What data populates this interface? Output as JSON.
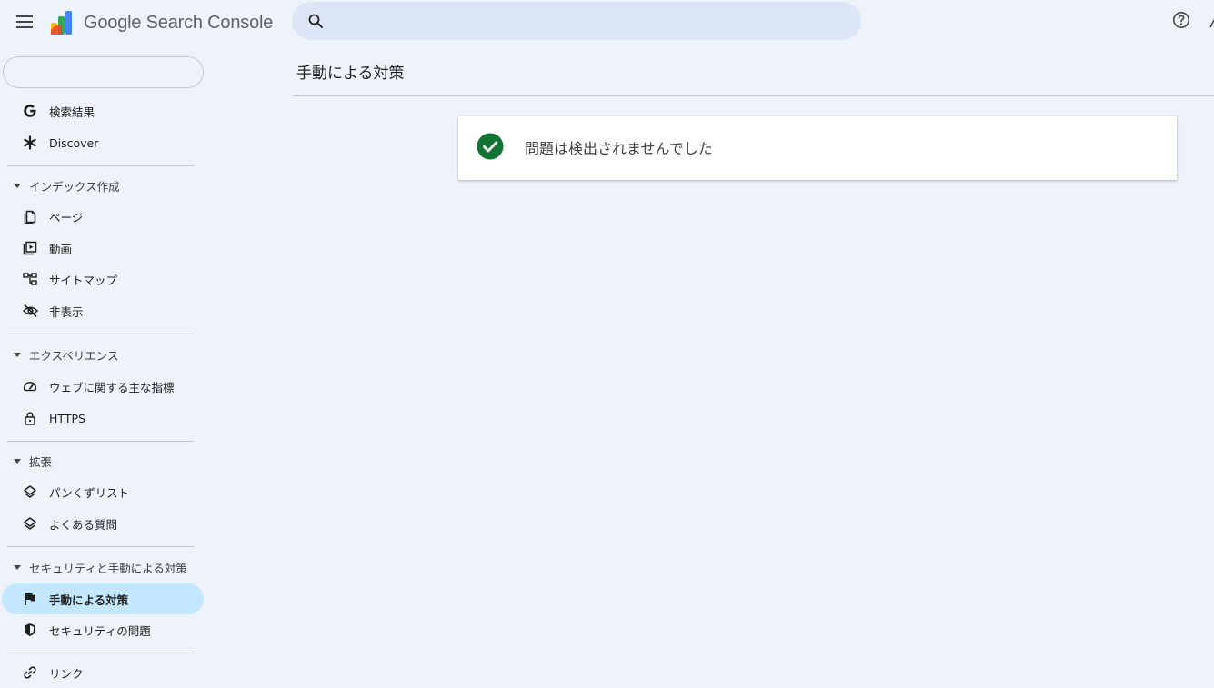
{
  "app": {
    "title": "Google Search Console"
  },
  "search": {
    "value": "",
    "placeholder": ""
  },
  "sidebar": {
    "property": "",
    "top_items": [
      {
        "label": "検索結果",
        "icon": "google-g-icon"
      },
      {
        "label": "Discover",
        "icon": "asterisk-icon"
      }
    ],
    "sections": [
      {
        "title": "インデックス作成",
        "items": [
          {
            "label": "ページ",
            "icon": "pages-icon"
          },
          {
            "label": "動画",
            "icon": "video-icon"
          },
          {
            "label": "サイトマップ",
            "icon": "sitemap-icon"
          },
          {
            "label": "非表示",
            "icon": "eye-off-icon"
          }
        ]
      },
      {
        "title": "エクスペリエンス",
        "items": [
          {
            "label": "ウェブに関する主な指標",
            "icon": "speed-icon"
          },
          {
            "label": "HTTPS",
            "icon": "lock-icon"
          }
        ]
      },
      {
        "title": "拡張",
        "items": [
          {
            "label": "パンくずリスト",
            "icon": "layers-icon"
          },
          {
            "label": "よくある質問",
            "icon": "layers-icon"
          }
        ]
      },
      {
        "title": "セキュリティと手動による対策",
        "items": [
          {
            "label": "手動による対策",
            "icon": "flag-icon",
            "active": true
          },
          {
            "label": "セキュリティの問題",
            "icon": "shield-icon"
          }
        ]
      }
    ],
    "bottom_items": [
      {
        "label": "リンク",
        "icon": "link-icon"
      }
    ]
  },
  "main": {
    "title": "手動による対策",
    "status_message": "問題は検出されませんでした"
  },
  "colors": {
    "background": "#eef2fa",
    "active_item": "#c2e7ff",
    "success": "#137333",
    "search_bg": "#dde6f7"
  }
}
